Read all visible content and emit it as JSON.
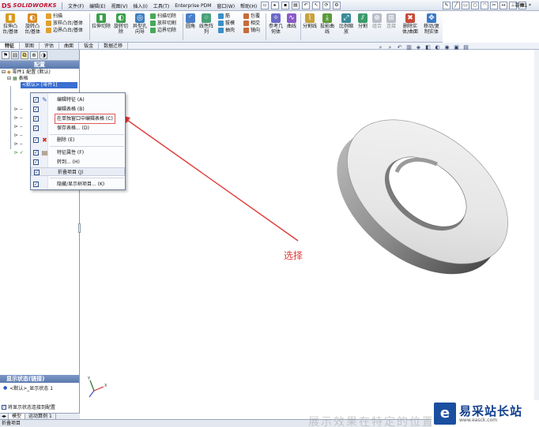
{
  "app": {
    "logo_ds": "DS",
    "logo_text": "SOLIDWORKS",
    "document": "零件1 *",
    "window_controls": "- ▫ ×"
  },
  "menus": [
    {
      "label": "文件(F)"
    },
    {
      "label": "编辑(E)"
    },
    {
      "label": "视图(V)"
    },
    {
      "label": "插入(I)"
    },
    {
      "label": "工具(T)"
    },
    {
      "label": "Enterprise PDM"
    },
    {
      "label": "窗口(W)"
    },
    {
      "label": "帮助(H)"
    }
  ],
  "commands": {
    "extrude_boss": "拉伸凸台/基体",
    "revolve_boss": "旋转凸台/基体",
    "sweep": "扫描",
    "loft": "放样凸台/基体",
    "boundary": "边界凸台/基体",
    "extrude_cut": "拉伸切除",
    "revolve_cut": "旋转切除",
    "hole": "异型孔向导",
    "sweep_cut": "扫描切除",
    "loft_cut": "放样切割",
    "boundary_cut": "边界切除",
    "fillet": "圆角",
    "linear_pattern": "线性阵列",
    "rib": "筋",
    "draft": "拔模",
    "shell": "抽壳",
    "wrap": "包覆",
    "intersect": "相交",
    "mirror": "镜向",
    "ref_geometry": "参考几何体",
    "curves": "曲线",
    "split_line": "分割线",
    "project_curve": "投影曲线",
    "scale": "比例缩放",
    "split": "分割",
    "combine": "组合",
    "join": "连接",
    "delete_body": "删除实体/曲面",
    "move_body": "移动/复制实体"
  },
  "tabs": [
    {
      "label": "特征",
      "active": true
    },
    {
      "label": "草图",
      "active": false
    },
    {
      "label": "评估",
      "active": false
    },
    {
      "label": "曲面",
      "active": false
    },
    {
      "label": "钣金",
      "active": false
    },
    {
      "label": "数据迁移",
      "active": false
    }
  ],
  "feature_manager": {
    "title": "配置",
    "root": "零件1 配置 (默认)",
    "tables": "表格",
    "selected": "<默认> [零件1]",
    "display_state_title": "显示状态(链接)",
    "display_state_item": "<默认>_显示状态 1",
    "link_option": "将显示状态连接到配置"
  },
  "context_menu": [
    {
      "label": "编辑特征 (A)",
      "checked": true,
      "icon": "✎"
    },
    {
      "label": "编辑表格 (B)",
      "checked": true,
      "icon": ""
    },
    {
      "label": "在单独窗口中编辑表格 (C)",
      "checked": true,
      "icon": ""
    },
    {
      "label": "保存表格... (D)",
      "checked": true,
      "icon": ""
    },
    {
      "label": "删除 (E)",
      "checked": true,
      "icon": "✖"
    },
    {
      "label": "特征属性 (F)",
      "checked": true,
      "icon": "▤"
    },
    {
      "label": "转到... (H)",
      "checked": true,
      "icon": ""
    },
    {
      "label": "折叠项目 (J)",
      "checked": true,
      "icon": ""
    },
    {
      "label": "隐藏/显示树项目... (K)",
      "checked": true,
      "icon": ""
    }
  ],
  "annotation": {
    "label": "选择",
    "color": "#e03a3a"
  },
  "bottom_tabs": [
    {
      "label": "模型"
    },
    {
      "label": "运动算例 1"
    }
  ],
  "status_text": "折叠项目",
  "watermark": {
    "title": "易采站长站",
    "url": "www.easck.com"
  },
  "bottom_ghost_text": "展示效果在特定的位置",
  "colors": {
    "accent": "#3a6fd0",
    "annotation": "#e03a3a",
    "pane_title": "#5a79ad"
  }
}
